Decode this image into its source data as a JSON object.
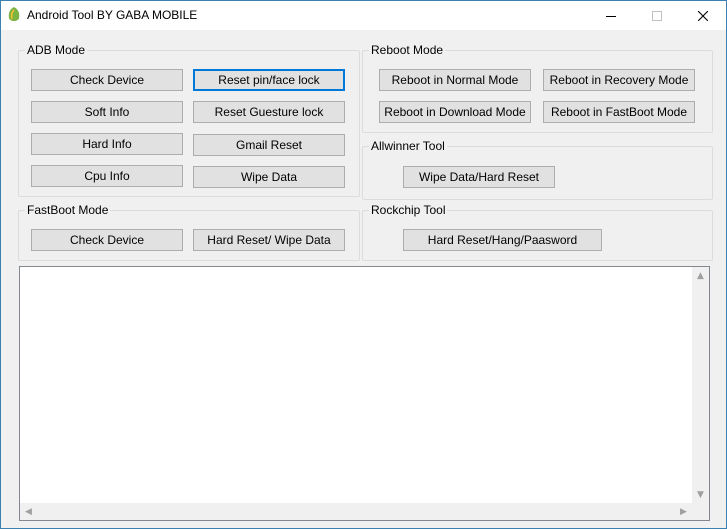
{
  "window": {
    "title": "Android Tool BY GABA MOBILE"
  },
  "adb": {
    "label": "ADB Mode",
    "check_device": "Check Device",
    "reset_pin": "Reset pin/face lock",
    "soft_info": "Soft Info",
    "reset_gesture": "Reset Guesture lock",
    "hard_info": "Hard Info",
    "gmail_reset": "Gmail Reset",
    "cpu_info": "Cpu Info",
    "wipe_data": "Wipe Data"
  },
  "reboot": {
    "label": "Reboot Mode",
    "normal": "Reboot in Normal Mode",
    "recovery": "Reboot in Recovery Mode",
    "download": "Reboot in Download Mode",
    "fastboot": "Reboot in FastBoot Mode"
  },
  "allwinner": {
    "label": "Allwinner Tool",
    "wipe": "Wipe Data/Hard Reset"
  },
  "fastboot": {
    "label": "FastBoot Mode",
    "check_device": "Check Device",
    "hard_reset": "Hard Reset/ Wipe Data"
  },
  "rockchip": {
    "label": "Rockchip Tool",
    "reset": "Hard Reset/Hang/Paasword"
  },
  "log": {
    "text": ""
  },
  "colors": {
    "focus_border": "#0078d7",
    "button_bg": "#e1e1e1",
    "window_bg": "#f0f0f0"
  }
}
